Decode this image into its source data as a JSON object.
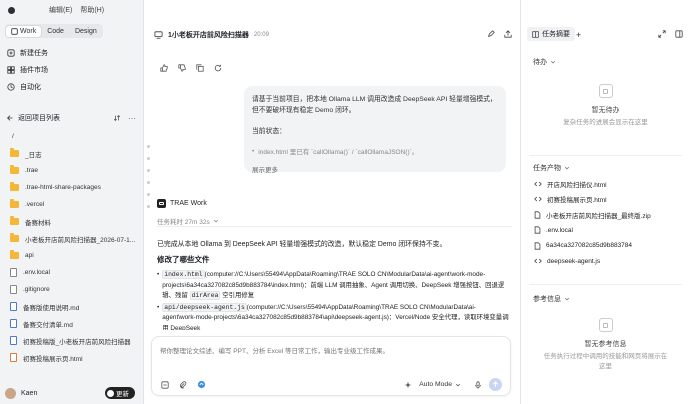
{
  "menu": {
    "items": [
      "编辑(E)",
      "帮助(H)"
    ]
  },
  "mode_tabs": [
    "Work",
    "Code",
    "Design"
  ],
  "sidebar": {
    "nav": [
      {
        "label": "新建任务",
        "icon": "new-task-icon"
      },
      {
        "label": "插件市场",
        "icon": "plugin-icon"
      },
      {
        "label": "自动化",
        "icon": "clock-icon"
      }
    ],
    "back_label": "返回项目列表",
    "root": "/",
    "files": [
      {
        "name": "_日志",
        "type": "folder"
      },
      {
        "name": ".trae",
        "type": "folder"
      },
      {
        "name": ".trae-html-share-packages",
        "type": "folder"
      },
      {
        "name": ".vercel",
        "type": "folder"
      },
      {
        "name": "备赛材料",
        "type": "folder"
      },
      {
        "name": "小老板开店前风险扫描器_2026-07-1...",
        "type": "folder"
      },
      {
        "name": "api",
        "type": "folder"
      },
      {
        "name": ".env.local",
        "type": "file"
      },
      {
        "name": ".gitignore",
        "type": "file"
      },
      {
        "name": "备赛版使用说明.md",
        "type": "md"
      },
      {
        "name": "备赛交付清单.md",
        "type": "md"
      },
      {
        "name": "初赛投稿版_小老板开店前风险扫描器",
        "type": "md"
      },
      {
        "name": "初赛投稿展示页.html",
        "type": "html"
      }
    ],
    "user": {
      "name": "Kaen",
      "update_label": "更新"
    }
  },
  "header": {
    "title": "1小老板开店前风险扫描器",
    "time": "20:09"
  },
  "user_message": {
    "text": "请基于当前项目，把本地 Ollama LLM 调用改造成 DeepSeek API 轻量增强模式，但不要破坏现有稳定 Demo 闭环。",
    "status_label": "当前状态：",
    "bullet": "index.html 里已有 `callOllama()` / `callOllamaJSON()`。",
    "expand_label": "展示更多"
  },
  "agent": {
    "name": "TRAE Work",
    "duration": "任务耗时 27m 32s",
    "summary": "已完成从本地 Ollama 到 DeepSeek API 轻量增强模式的改造，默认稳定 Demo 闭环保持不变。",
    "section_title": "修改了哪些文件",
    "files": [
      {
        "code": "index.html",
        "path": "(computer://C:\\Users\\55494\\AppData\\Roaming\\TRAE SOLO CN\\ModularData\\ai-agent\\work-mode-projects\\6a34ca327082c85d9b883784\\index.html)：前端 LLM 调用抽象、Agent 调用切换、DeepSeek 增强按钮、回退逻辑、残留 ",
        "code2": "dirArea",
        "tail": " 空引用修复"
      },
      {
        "code": "api/deepseek-agent.js",
        "path": "(computer://C:\\Users\\55494\\AppData\\Roaming\\TRAE SOLO CN\\ModularData\\ai-agent\\work-mode-projects\\6a34ca327082c85d9b883784\\api\\deepseek-agent.js)：Vercel/Node 安全代理，读取环境变量调用 DeepSeek"
      }
    ]
  },
  "input": {
    "placeholder": "帮你整理论文综述、编写 PPT、分析 Excel 等日常工作，输出专业级工作成果。",
    "mode_label": "Auto Mode"
  },
  "right_panel": {
    "tab_label": "任务摘要",
    "todo": {
      "title": "待办",
      "empty_title": "暂无待办",
      "empty_sub": "复杂任务的进展会显示在这里"
    },
    "products": {
      "title": "任务产物",
      "items": [
        {
          "name": "开店风险扫描仪.html",
          "icon": "code-icon"
        },
        {
          "name": "初赛投稿展示页.html",
          "icon": "code-icon"
        },
        {
          "name": "小老板开店前风险扫描器_最终版.zip",
          "icon": "file-icon"
        },
        {
          "name": ".env.local",
          "icon": "file-icon"
        },
        {
          "name": "6a34ca327082c85d9b883784",
          "icon": "file-icon"
        },
        {
          "name": "deepseek-agent.js",
          "icon": "code-icon"
        }
      ]
    },
    "refs": {
      "title": "参考信息",
      "empty_title": "暂无参考信息",
      "empty_sub": "任务执行过程中调用的技能和网页将展示在这里"
    }
  }
}
